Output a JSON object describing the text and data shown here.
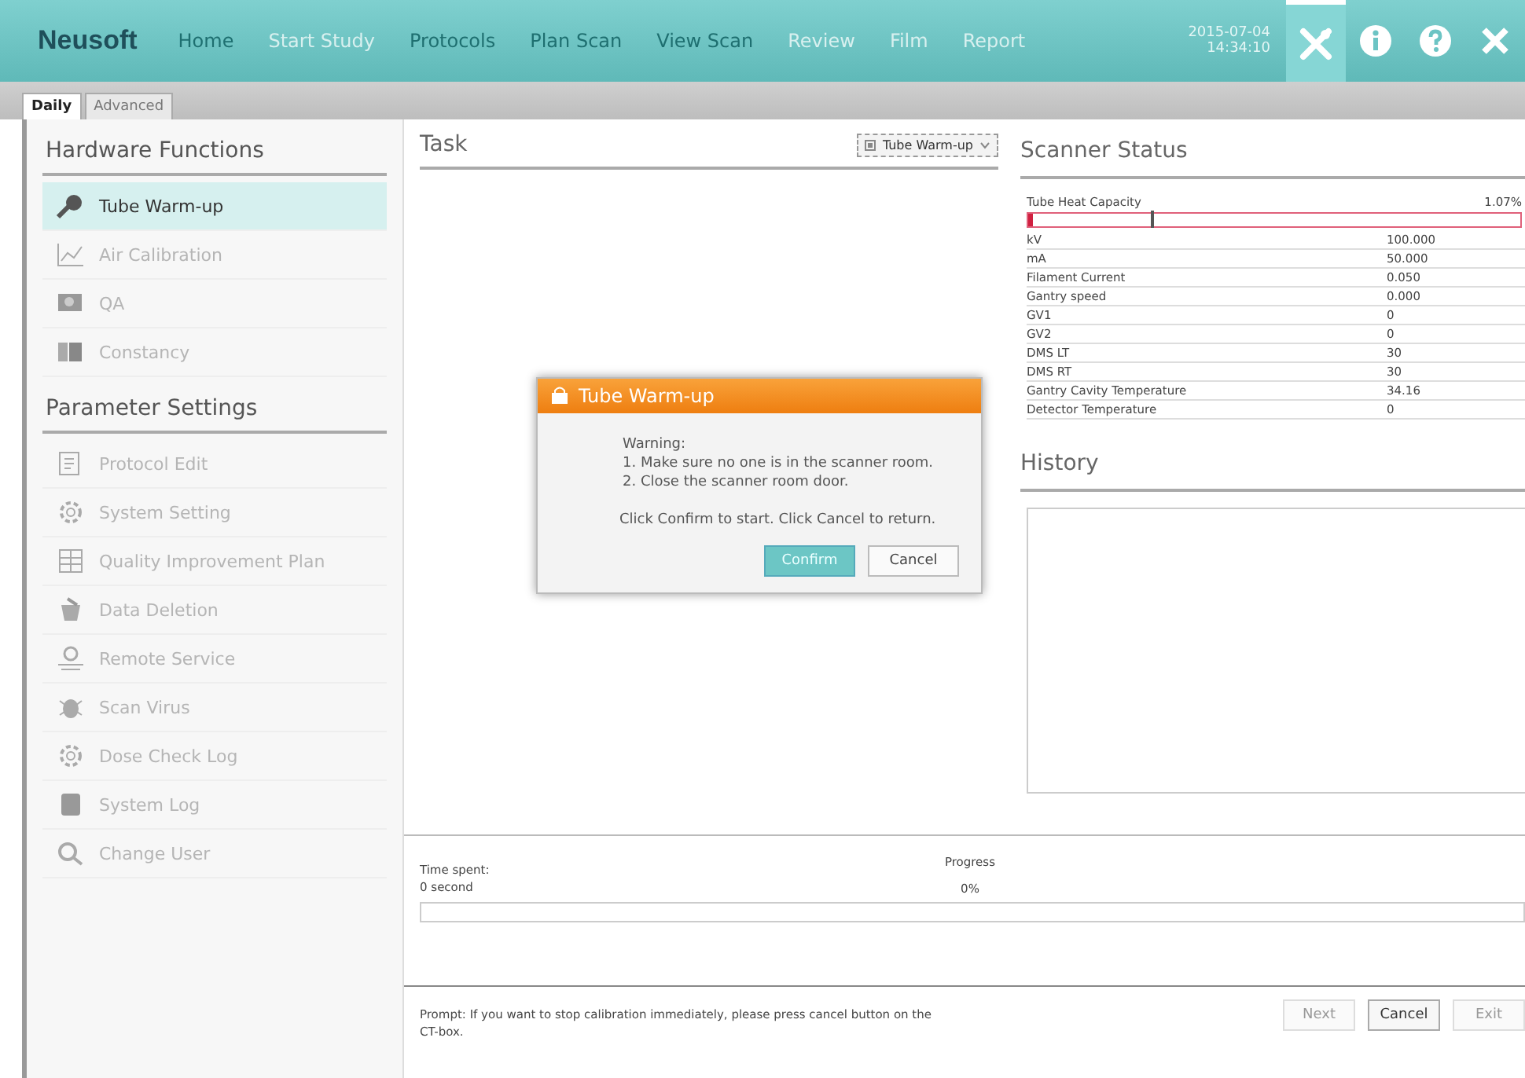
{
  "header": {
    "logo": "Neusoft",
    "nav": [
      {
        "label": "Home",
        "disabled": false
      },
      {
        "label": "Start Study",
        "disabled": true
      },
      {
        "label": "Protocols",
        "disabled": false
      },
      {
        "label": "Plan Scan",
        "disabled": false
      },
      {
        "label": "View Scan",
        "disabled": false
      },
      {
        "label": "Review",
        "disabled": true
      },
      {
        "label": "Film",
        "disabled": true
      },
      {
        "label": "Report",
        "disabled": true
      }
    ],
    "date": "2015-07-04",
    "time": "14:34:10",
    "tools": [
      {
        "selected": true
      },
      {
        "selected": false
      },
      {
        "selected": false
      },
      {
        "selected": false
      }
    ]
  },
  "tabs": [
    {
      "label": "Daily",
      "selected": true
    },
    {
      "label": "Advanced",
      "selected": false
    }
  ],
  "sidebar": {
    "sections": [
      {
        "title": "Hardware Functions",
        "items": [
          {
            "label": "Tube Warm-up",
            "selected": true,
            "disabled": false
          },
          {
            "label": "Air Calibration",
            "selected": false,
            "disabled": true
          },
          {
            "label": "QA",
            "selected": false,
            "disabled": true
          },
          {
            "label": "Constancy",
            "selected": false,
            "disabled": true
          }
        ]
      },
      {
        "title": "Parameter Settings",
        "items": [
          {
            "label": "Protocol Edit",
            "selected": false,
            "disabled": true
          },
          {
            "label": "System Setting",
            "selected": false,
            "disabled": true
          },
          {
            "label": "Quality Improvement Plan",
            "selected": false,
            "disabled": true
          },
          {
            "label": "Data Deletion",
            "selected": false,
            "disabled": true
          },
          {
            "label": "Remote Service",
            "selected": false,
            "disabled": true
          },
          {
            "label": "Scan Virus",
            "selected": false,
            "disabled": true
          },
          {
            "label": "Dose Check Log",
            "selected": false,
            "disabled": true
          },
          {
            "label": "System Log",
            "selected": false,
            "disabled": true
          },
          {
            "label": "Change User",
            "selected": false,
            "disabled": true
          }
        ]
      }
    ]
  },
  "task": {
    "title": "Task",
    "selector": "Tube Warm-up"
  },
  "scanner_status": {
    "title": "Scanner Status",
    "heat_label": "Tube Heat Capacity",
    "heat_value": "1.07%",
    "heat_bar": {
      "level": 0.0107
    },
    "rows": [
      {
        "name": "kV",
        "value": "100.000"
      },
      {
        "name": "mA",
        "value": "50.000"
      },
      {
        "name": "Filament Current",
        "value": "0.050"
      },
      {
        "name": "Gantry speed",
        "value": "0.000"
      },
      {
        "name": "GV1",
        "value": "0"
      },
      {
        "name": "GV2",
        "value": "0"
      },
      {
        "name": "DMS LT",
        "value": "30"
      },
      {
        "name": "DMS RT",
        "value": "30"
      },
      {
        "name": "Gantry Cavity Temperature",
        "value": "34.16"
      },
      {
        "name": "Detector Temperature",
        "value": "0"
      }
    ]
  },
  "history": {
    "title": "History"
  },
  "progress": {
    "time_label": "Time spent:",
    "time_value": "0 second",
    "label": "Progress",
    "value": "0%",
    "level": 0
  },
  "prompt": "Prompt: If you want to stop calibration immediately, please press cancel button on the CT-box.",
  "buttons": [
    {
      "label": "Next",
      "disabled": true
    },
    {
      "label": "Cancel",
      "disabled": false
    },
    {
      "label": "Exit",
      "disabled": true
    }
  ],
  "dialog": {
    "title": "Tube Warm-up",
    "lines": [
      "Warning:",
      "1.  Make sure no one is in the scanner room.",
      "2.  Close the scanner room door."
    ],
    "note": "Click Confirm to start. Click Cancel to return.",
    "buttons": [
      {
        "label": "Confirm",
        "primary": true
      },
      {
        "label": "Cancel",
        "primary": false
      }
    ]
  }
}
